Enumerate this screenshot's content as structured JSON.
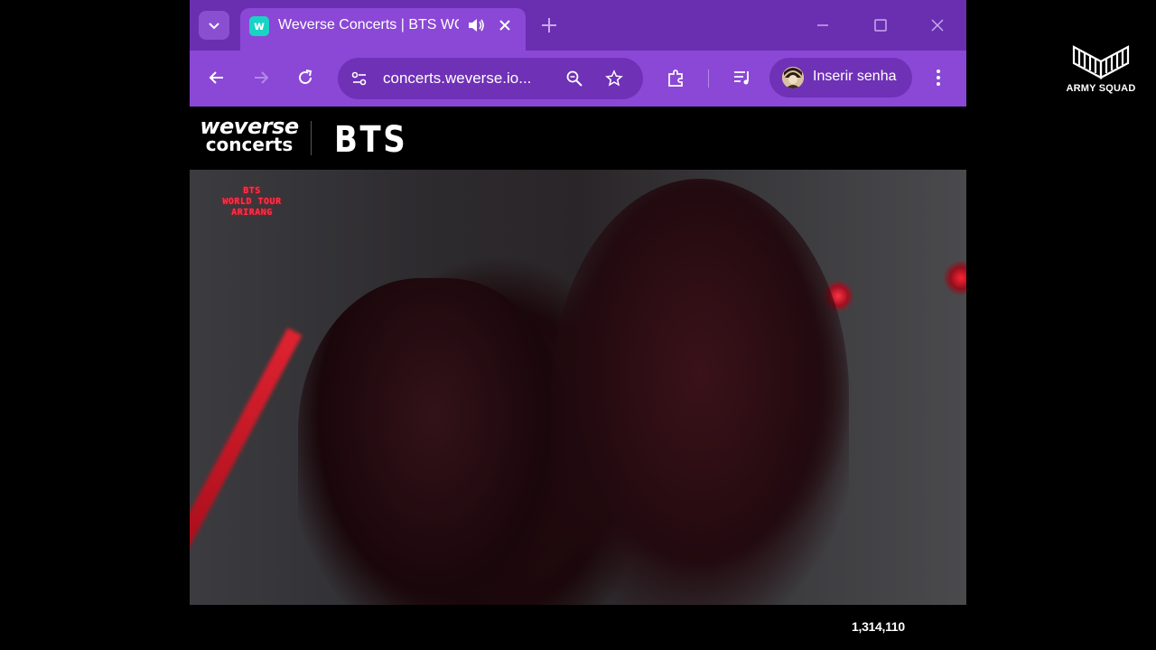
{
  "watermark": {
    "label": "ARMY SQUAD"
  },
  "browser": {
    "tab": {
      "title": "Weverse Concerts | BTS WORLD TOUR ARIRANG",
      "favicon_letter": "w"
    },
    "address_bar": {
      "url": "concerts.weverse.io..."
    },
    "profile": {
      "label": "Inserir senha"
    }
  },
  "site": {
    "logo_line1": "weverse",
    "logo_line2": "concerts",
    "artist": "BTS"
  },
  "video": {
    "overlay_lines": [
      "BTS",
      "WORLD TOUR",
      "ARIRANG"
    ]
  },
  "player": {
    "viewer_count": "1,314,110"
  },
  "colors": {
    "tabstrip": "#6a2fb0",
    "toolbar": "#8b48d6",
    "favicon": "#17d4c4"
  }
}
